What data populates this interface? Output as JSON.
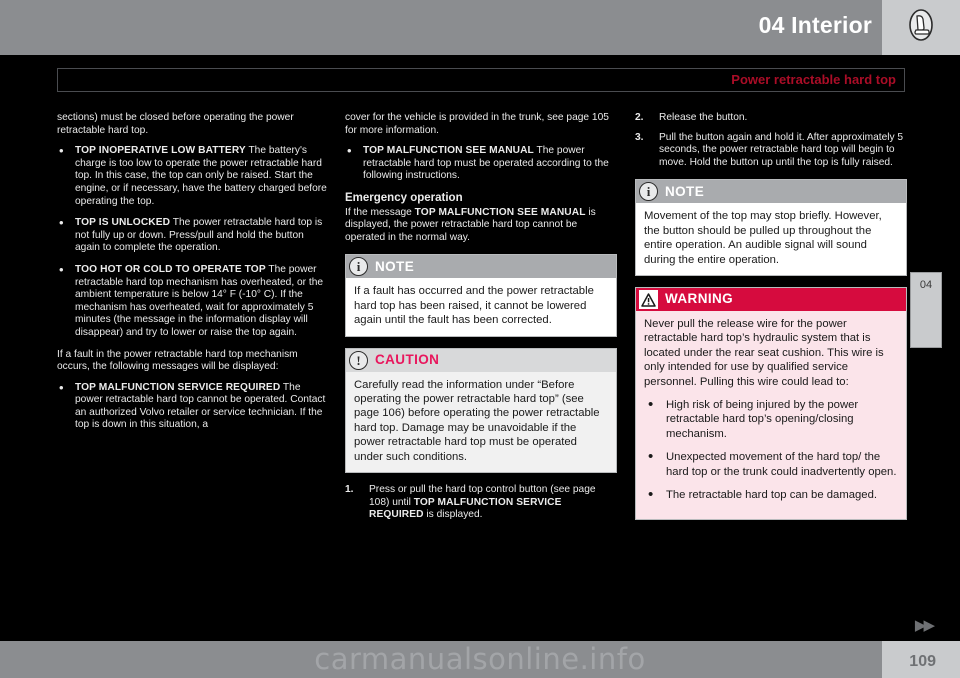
{
  "header": {
    "chapter_title": "04 Interior",
    "seat_icon": "car-seat-icon",
    "subtitle": "Power retractable hard top"
  },
  "chapter_tab": {
    "number": "04"
  },
  "columns": {
    "left": {
      "intro_paragraph": "sections) must be closed before operating the power retractable hard top.",
      "bullets": [
        {
          "message": "TOP INOPERATIVE LOW BATTERY",
          "text": " The battery's charge is too low to operate the power retractable hard top. In this case, the top can only be raised. Start the engine, or if necessary, have the battery charged before operating the top."
        },
        {
          "message": "TOP IS UNLOCKED",
          "text": " The power retractable hard top is not fully up or down. Press/pull and hold the button again to complete the operation."
        },
        {
          "message": "TOO HOT OR COLD TO OPERATE TOP",
          "text": " The power retractable hard top mechanism has overheated, or the ambient temperature is below 14° F (-10° C). If the mechanism has overheated, wait for approximately 5 minutes (the message in the information display will disappear) and try to lower or raise the top again."
        }
      ],
      "fault_paragraph": "If a fault in the power retractable hard top mechanism occurs, the following messages will be displayed:",
      "fault_bullets": [
        {
          "message": "TOP MALFUNCTION SERVICE REQUIRED",
          "text": " The power retractable hard top cannot be operated. Contact an authorized Volvo retailer or service technician. If the top is down in this situation, a"
        }
      ]
    },
    "middle": {
      "continuation_paragraph": "cover for the vehicle is provided in the trunk, see page 105 for more information.",
      "bullets": [
        {
          "message": "TOP MALFUNCTION SEE MANUAL",
          "text": " The power retractable hard top must be operated according to the following instructions."
        }
      ],
      "section_heading": "Emergency operation",
      "section_paragraph_pre": "If the message ",
      "section_paragraph_msg": "TOP MALFUNCTION SEE MANUAL",
      "section_paragraph_post": " is displayed, the power retractable hard top cannot be operated in the normal way.",
      "note": {
        "icon": "info-icon",
        "title": "NOTE",
        "body": "If a fault has occurred and the power retractable hard top has been raised, it cannot be lowered again until the fault has been corrected."
      },
      "caution": {
        "icon": "exclamation-icon",
        "title": "CAUTION",
        "body": "Carefully read the information under “Before operating the power retractable hard top” (see page 106) before operating the power retractable hard top. Damage may be unavoidable if the power retractable hard top must be operated under such conditions."
      },
      "steps": [
        {
          "num": "1.",
          "pre": "Press or pull the hard top control button (see page 108) until ",
          "msg": "TOP MALFUNCTION SERVICE REQUIRED",
          "post": " is displayed."
        }
      ]
    },
    "right": {
      "steps": [
        {
          "num": "2.",
          "text": "Release the button."
        },
        {
          "num": "3.",
          "text": "Pull the button again and hold it. After approximately 5 seconds, the power retractable hard top will begin to move. Hold the button up until the top is fully raised."
        }
      ],
      "note": {
        "icon": "info-icon",
        "title": "NOTE",
        "body": "Movement of the top may stop briefly. However, the button should be pulled up throughout the entire operation. An audible signal will sound during the entire operation."
      },
      "warning": {
        "icon": "warning-triangle-icon",
        "title": "WARNING",
        "body": "Never pull the release wire for the power retractable hard top’s hydraulic system that is located under the rear seat cushion. This wire is only intended for use by qualified service personnel. Pulling this wire could lead to:",
        "bullets": [
          "High risk of being injured by the power retractable hard top’s opening/closing mechanism.",
          "Unexpected movement of the hard top/ the hard top or the trunk could inadvertently open.",
          "The retractable hard top can be damaged."
        ]
      }
    }
  },
  "footer": {
    "next_arrow": "▶▶",
    "page_number": "109",
    "watermark": "carmanualsonline.info"
  },
  "colors": {
    "header_band": "#8b8d90",
    "header_cell": "#c9cbcd",
    "subtitle_red": "#c8102e",
    "warning_red": "#d60b3e",
    "caution_pink": "#e8175d",
    "warning_body": "#fbe4ea"
  }
}
